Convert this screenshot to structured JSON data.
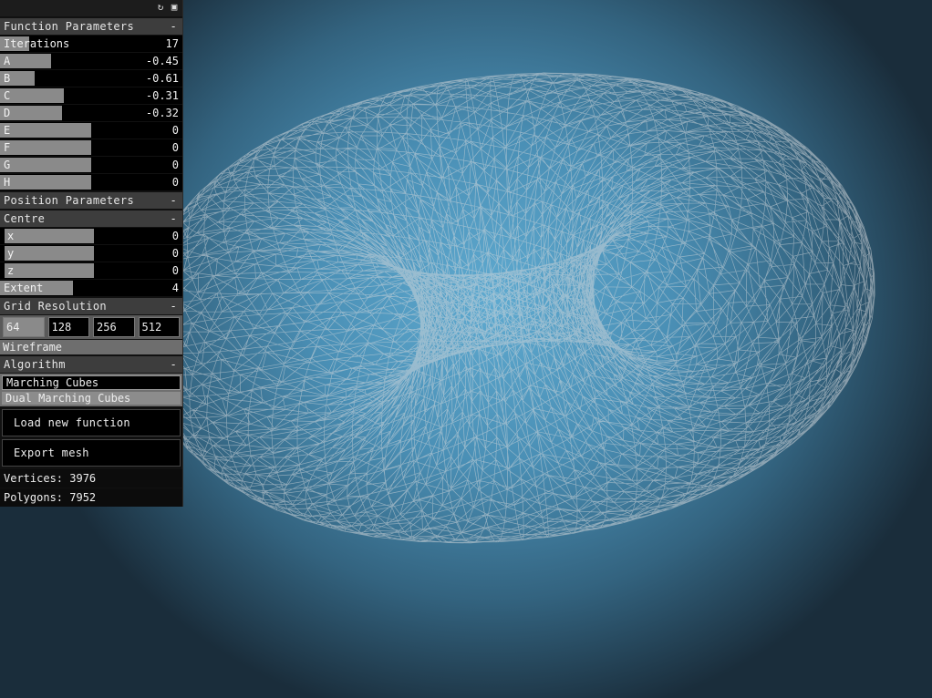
{
  "toolbar": {
    "refresh_icon": "refresh-icon",
    "save_icon": "save-icon"
  },
  "function_parameters": {
    "title": "Function Parameters",
    "toggle": "-",
    "rows": [
      {
        "label": "Iterations",
        "value": "17",
        "fill": 0.16
      },
      {
        "label": "A",
        "value": "-0.45",
        "fill": 0.28
      },
      {
        "label": "B",
        "value": "-0.61",
        "fill": 0.19
      },
      {
        "label": "C",
        "value": "-0.31",
        "fill": 0.35
      },
      {
        "label": "D",
        "value": "-0.32",
        "fill": 0.34
      },
      {
        "label": "E",
        "value": "0",
        "fill": 0.5
      },
      {
        "label": "F",
        "value": "0",
        "fill": 0.5
      },
      {
        "label": "G",
        "value": "0",
        "fill": 0.5
      },
      {
        "label": "H",
        "value": "0",
        "fill": 0.5
      }
    ]
  },
  "position_parameters": {
    "title": "Position Parameters",
    "toggle": "-"
  },
  "centre": {
    "title": "Centre",
    "toggle": "-",
    "rows": [
      {
        "label": "x",
        "value": "0",
        "fill": 0.5
      },
      {
        "label": "y",
        "value": "0",
        "fill": 0.5
      },
      {
        "label": "z",
        "value": "0",
        "fill": 0.5
      }
    ],
    "extent": {
      "label": "Extent",
      "value": "4",
      "fill": 0.4
    }
  },
  "grid_resolution": {
    "title": "Grid Resolution",
    "toggle": "-",
    "options": [
      "64",
      "128",
      "256",
      "512"
    ],
    "selected": "64"
  },
  "wireframe_label": "Wireframe",
  "algorithm": {
    "title": "Algorithm",
    "toggle": "-",
    "options": [
      "Marching Cubes",
      "Dual Marching Cubes"
    ],
    "selected": "Marching Cubes"
  },
  "buttons": {
    "load": "Load new function",
    "export": "Export mesh"
  },
  "stats": {
    "vertices": "Vertices: 3976",
    "polygons": "Polygons: 7952"
  },
  "colors": {
    "background_center": "#5faad0",
    "background_edge": "#1a2d3b",
    "mesh": "#d4d7da"
  }
}
